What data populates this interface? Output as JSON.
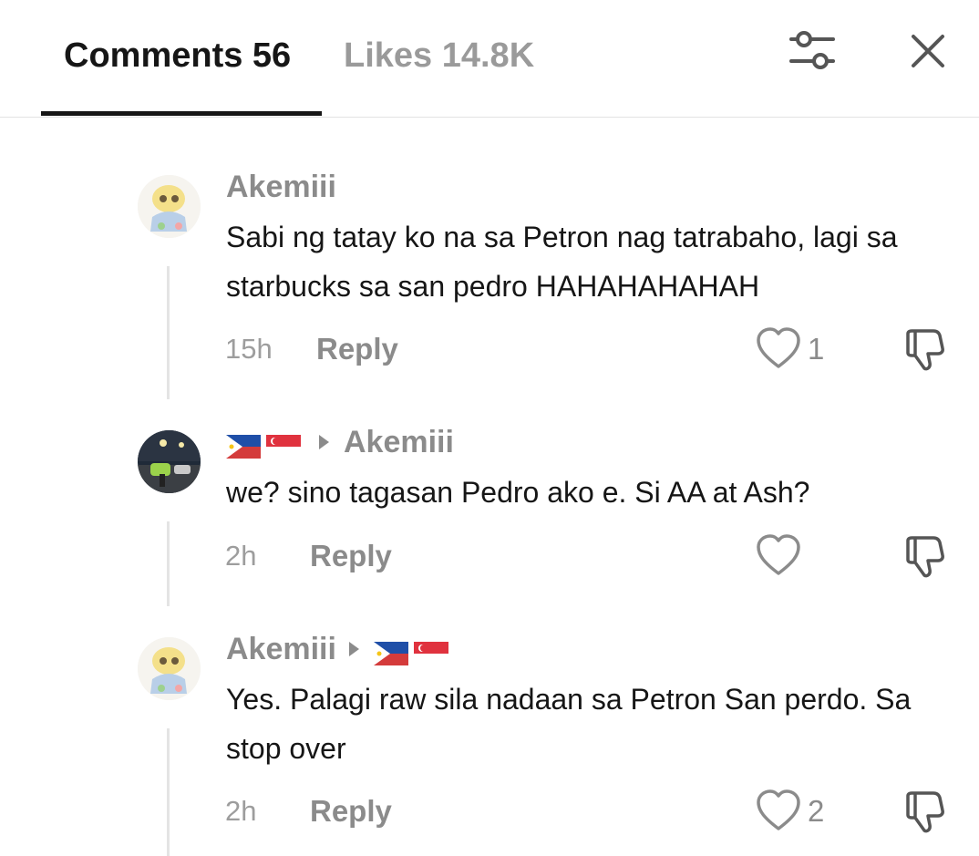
{
  "header": {
    "comments_tab": "Comments 56",
    "likes_tab": "Likes 14.8K"
  },
  "comments": [
    {
      "username": "Akemiii",
      "text": "Sabi ng tatay ko na sa Petron nag tatrabaho, lagi sa starbucks sa san pedro HAHAHAHAHAH",
      "time": "15h",
      "reply_label": "Reply",
      "likes": "1"
    },
    {
      "username_flags": [
        "philippines-flag",
        "singapore-flag"
      ],
      "reply_to": "Akemiii",
      "text": "we? sino tagasan Pedro ako e. Si AA at Ash?",
      "time": "2h",
      "reply_label": "Reply",
      "likes": ""
    },
    {
      "username": "Akemiii",
      "reply_to_flags": [
        "philippines-flag",
        "singapore-flag"
      ],
      "text": "Yes. Palagi raw sila nadaan sa Petron San perdo. Sa stop over",
      "time": "2h",
      "reply_label": "Reply",
      "likes": "2"
    }
  ],
  "colors": {
    "primary_text": "#161616",
    "secondary_text": "#8b8b8b",
    "divider": "#e2e2e2"
  },
  "icons": [
    "filter-sliders-icon",
    "close-icon",
    "heart-icon",
    "dislike-icon",
    "chevron-right-icon"
  ]
}
